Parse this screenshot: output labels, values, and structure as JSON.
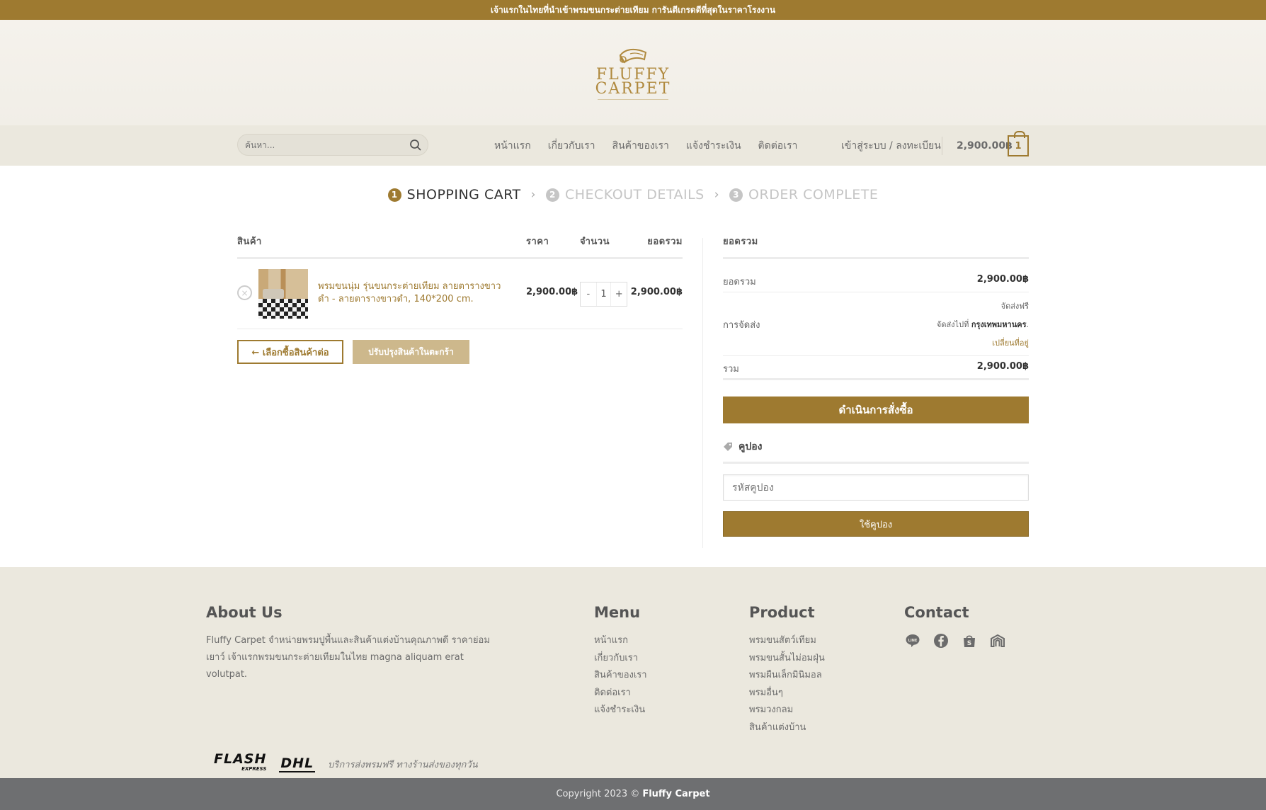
{
  "topbar": {
    "text": "เจ้าแรกในไทยที่นำเข้าพรมขนกระต่ายเทียม การันตีเกรดดีที่สุดในราคาโรงงาน"
  },
  "logo": {
    "line1": "FLUFFY",
    "line2": "CARPET"
  },
  "search": {
    "placeholder": "ค้นหา..."
  },
  "nav": {
    "items": [
      "หน้าแรก",
      "เกี่ยวกับเรา",
      "สินค้าของเรา",
      "แจ้งชำระเงิน",
      "ติดต่อเรา"
    ]
  },
  "account": {
    "login_label": "เข้าสู่ระบบ / ลงทะเบียน"
  },
  "header_cart": {
    "total": "2,900.00฿",
    "count": "1"
  },
  "steps": [
    {
      "num": "1",
      "label": "SHOPPING CART"
    },
    {
      "num": "2",
      "label": "CHECKOUT DETAILS"
    },
    {
      "num": "3",
      "label": "ORDER COMPLETE"
    }
  ],
  "cart_table": {
    "headers": {
      "product": "สินค้า",
      "price": "ราคา",
      "quantity": "จำนวน",
      "subtotal": "ยอดรวม"
    },
    "rows": [
      {
        "name": "พรมขนนุ่ม รุ่นขนกระต่ายเทียม ลายตารางขาวดำ - ลายตารางขาวดำ, 140*200 cm.",
        "price": "2,900.00฿",
        "quantity": "1",
        "subtotal": "2,900.00฿"
      }
    ],
    "qty_minus": "-",
    "qty_plus": "+",
    "remove_icon": "×",
    "continue_button": "← เลือกซื้อสินค้าต่อ",
    "update_button": "ปรับปรุงสินค้าในตะกร้า"
  },
  "totals": {
    "heading": "ยอดรวม",
    "subtotal_label": "ยอดรวม",
    "subtotal_value": "2,900.00฿",
    "shipping_label": "การจัดส่ง",
    "shipping_method": "จัดส่งฟรี",
    "shipping_to_prefix": "จัดส่งไปที่",
    "shipping_to_city": "กรุงเทพมหานคร",
    "shipping_to_suffix": ".",
    "change_address": "เปลี่ยนที่อยู่",
    "total_label": "รวม",
    "total_value": "2,900.00฿",
    "checkout_button": "ดำเนินการสั่งซื้อ"
  },
  "coupon": {
    "heading": "คูปอง",
    "placeholder": "รหัสคูปอง",
    "apply_button": "ใช้คูปอง"
  },
  "footer": {
    "about_title": "About Us",
    "about_text": "Fluffy Carpet จำหน่ายพรมปูพื้นและสินค้าแต่งบ้านคุณภาพดี ราคาย่อมเยาว์ เจ้าแรกพรมขนกระต่ายเทียมในไทย magna aliquam erat volutpat.",
    "menu_title": "Menu",
    "menu_items": [
      "หน้าแรก",
      "เกี่ยวกับเรา",
      "สินค้าของเรา",
      "ติดต่อเรา",
      "แจ้งชำระเงิน"
    ],
    "product_title": "Product",
    "product_items": [
      "พรมขนสัตว์เทียม",
      "พรมขนสั้นไม่อมฝุ่น",
      "พรมผืนเล็กมินิมอล",
      "พรมอื่นๆ",
      "พรมวงกลม",
      "สินค้าแต่งบ้าน"
    ],
    "contact_title": "Contact",
    "social_icons": [
      "line-icon",
      "facebook-icon",
      "shopee-icon",
      "lazada-icon"
    ],
    "courier_flash": "FLASH",
    "courier_flash_sub": "EXPRESS",
    "courier_dhl": "DHL",
    "courier_text": "บริการส่งพรมฟรี ทางร้านส่งของทุกวัน"
  },
  "copyright": {
    "prefix": "Copyright 2023 ©",
    "brand": "Fluffy Carpet"
  },
  "colors": {
    "accent": "#9e7a30",
    "footer_bg": "#ebe8de",
    "copyright_bg": "#6e6f71",
    "update_btn": "#cdb88c"
  }
}
